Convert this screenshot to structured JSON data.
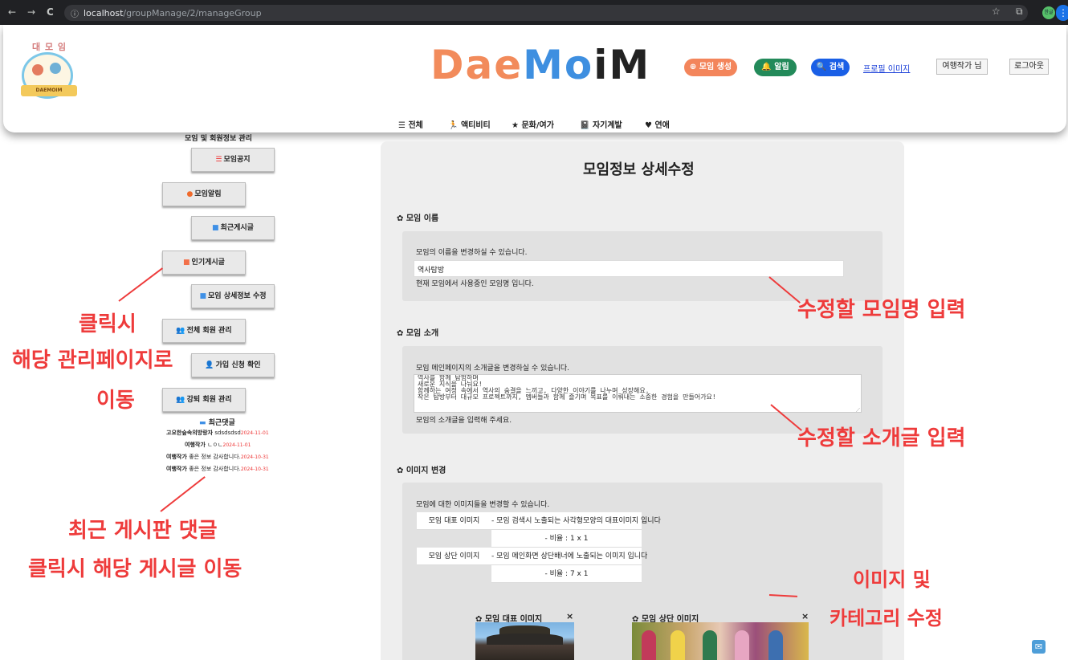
{
  "browser": {
    "url_host": "localhost",
    "url_path": "/groupManage/2/manageGroup",
    "profile_initials": "한글",
    "nav_back": "←",
    "nav_forward": "→",
    "nav_reload": "C",
    "info_glyph": "ⓘ",
    "star_glyph": "☆",
    "ext_glyph": "⧉",
    "menu_glyph": "⋮"
  },
  "header": {
    "small_logo_title": "대 모 임",
    "small_logo_ribbon": "DAEMOIM",
    "brand": [
      "Dae",
      "Mo",
      "iM"
    ],
    "create_button": "⊕ 모임 생성",
    "alarm_button": "🔔 알림",
    "search_button": "🔍 검색",
    "profile_image_alt": "프로필 이미지",
    "user_name": "여행작가 님",
    "logout": "로그아웃"
  },
  "categories": [
    {
      "icon": "☰",
      "label": "전체"
    },
    {
      "icon": "🏃",
      "label": "액티비티"
    },
    {
      "icon": "★",
      "label": "문화/여가"
    },
    {
      "icon": "📓",
      "label": "자기계발"
    },
    {
      "icon": "♥",
      "label": "연애"
    }
  ],
  "sidebar": {
    "title": "모임 및 회원정보 관리",
    "items": [
      {
        "icon": "☰",
        "icon_color": "#e33",
        "label": "모임공지"
      },
      {
        "icon": "●",
        "icon_color": "#f06a2b",
        "label": "모임알림"
      },
      {
        "icon": "■",
        "icon_color": "#3f90e6",
        "label": "최근게시글"
      },
      {
        "icon": "■",
        "icon_color": "#f2704a",
        "label": "인기게시글"
      },
      {
        "icon": "■",
        "icon_color": "#3f90e6",
        "label": "모임 상세정보 수정"
      },
      {
        "icon": "👥",
        "icon_color": "#3f90e6",
        "label": "전체 회원 관리"
      },
      {
        "icon": "👤",
        "icon_color": "#3f90e6",
        "label": "가입 신청 확인"
      },
      {
        "icon": "👥",
        "icon_color": "#3f90e6",
        "label": "강퇴 회원 관리"
      }
    ],
    "recent_comments_title": "최근댓글",
    "recent_comments": [
      {
        "author": "고요한숲속의방랑자",
        "text": "sdsdsdsd",
        "date": "2024-11-01"
      },
      {
        "author": "여행작가",
        "text": "ㄴㅇㄴ",
        "date": "2024-11-01"
      },
      {
        "author": "여행작가",
        "text": "좋은 정보 감사합니다.",
        "date": "2024-10-31"
      },
      {
        "author": "여행작가",
        "text": "좋은 정보 감사합니다.",
        "date": "2024-10-31"
      }
    ]
  },
  "main": {
    "title": "모임정보 상세수정",
    "name_section": {
      "title": "✿ 모임 이름",
      "help": "모임의 이름을 변경하실 수 있습니다.",
      "value": "역사탐방",
      "note": "현재 모임에서 사용중인 모임명 입니다."
    },
    "intro_section": {
      "title": "✿ 모임 소개",
      "help": "모임 메인페이지의 소개글을 변경하실 수 있습니다.",
      "value": "역사를 함께 탐험하며\n새로운 지식을 나눠요!\n함께하는 여정 속에서 역사의 숨결을 느끼고, 다양한 이야기를 나누며 성장해요.\n작은 탐방부터 대규모 프로젝트까지, 멤버들과 함께 즐기며 목표를 이뤄내는 소중한 경험을 만들어가요!",
      "note": "모임의 소개글을 입력해 주세요."
    },
    "image_section": {
      "title": "✿ 이미지 변경",
      "help": "모임에 대한 이미지들을 변경할 수 있습니다.",
      "rows": [
        {
          "label": "모임 대표 이미지",
          "desc": "- 모임 검색시 노출되는 사각형모양의 대표이미지 입니다",
          "ratio": "- 비율 : 1 x 1"
        },
        {
          "label": "모임 상단 이미지",
          "desc": "- 모임 메인화면 상단배너에 노출되는 이미지 입니다",
          "ratio": "- 비율 : 7 x 1"
        }
      ],
      "rep_image_label": "✿ 모임 대표 이미지",
      "top_image_label": "✿ 모임 상단 이미지",
      "close": "×"
    }
  },
  "annotations": {
    "sidebar_click_1": "클릭시",
    "sidebar_click_2": "해당 관리페이지로",
    "sidebar_click_3": "이동",
    "comments_1": "최근 게시판 댓글",
    "comments_2": "클릭시 해당 게시글 이동",
    "name_edit": "수정할 모임명 입력",
    "intro_edit": "수정할 소개글 입력",
    "image_1": "이미지 및",
    "image_2": "카테고리 수정",
    "color": "#ee3b3b"
  },
  "mail_icon": "✉"
}
